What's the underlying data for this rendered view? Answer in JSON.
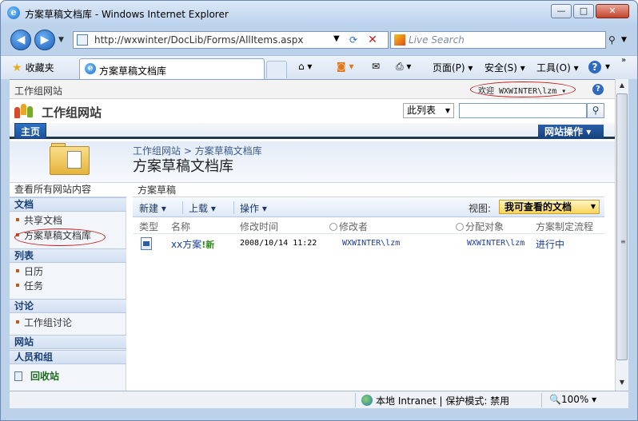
{
  "window": {
    "title": "方案草稿文档库 - Windows Internet Explorer",
    "controls": {
      "minimize": "—",
      "maximize": "□",
      "close": "✕"
    }
  },
  "address": {
    "url": "http://wxwinter/DocLib/Forms/AllItems.aspx",
    "search_placeholder": "Live Search"
  },
  "commandbar": {
    "favorites": "收藏夹",
    "tab_title": "方案草稿文档库",
    "page": "页面(P)",
    "safety": "安全(S)",
    "tools": "工具(O)",
    "help": "?"
  },
  "sharepoint": {
    "site_small": "工作组网站",
    "welcome": "欢迎 WXWINTER\\lzm",
    "site_title": "工作组网站",
    "search_scope": "此列表",
    "home_tab": "主页",
    "site_actions": "网站操作",
    "breadcrumb": "工作组网站 > 方案草稿文档库",
    "page_title": "方案草稿文档库",
    "leftnav": {
      "view_all": "查看所有网站内容",
      "docs_head": "文档",
      "docs_items": [
        "共享文档",
        "方案草稿文档库"
      ],
      "lists_head": "列表",
      "lists_items": [
        "日历",
        "任务"
      ],
      "discuss_head": "讨论",
      "discuss_items": [
        "工作组讨论"
      ],
      "sites_head": "网站",
      "people_head": "人员和组",
      "recycle": "回收站"
    },
    "list": {
      "name": "方案草稿",
      "toolbar": {
        "new": "新建",
        "upload": "上载",
        "actions": "操作"
      },
      "view_label": "视图:",
      "view_value": "我可查看的文档",
      "columns": [
        "类型",
        "名称",
        "修改时间",
        "修改者",
        "分配对象",
        "方案制定流程"
      ],
      "rows": [
        {
          "name": "xx方案",
          "new_badge": "新",
          "modified": "2008/10/14 11:22",
          "modified_by": "WXWINTER\\lzm",
          "assigned_to": "WXWINTER\\lzm",
          "workflow": "进行中"
        }
      ]
    }
  },
  "status": {
    "zone": "本地 Intranet | 保护模式: 禁用",
    "zoom": "100%"
  }
}
